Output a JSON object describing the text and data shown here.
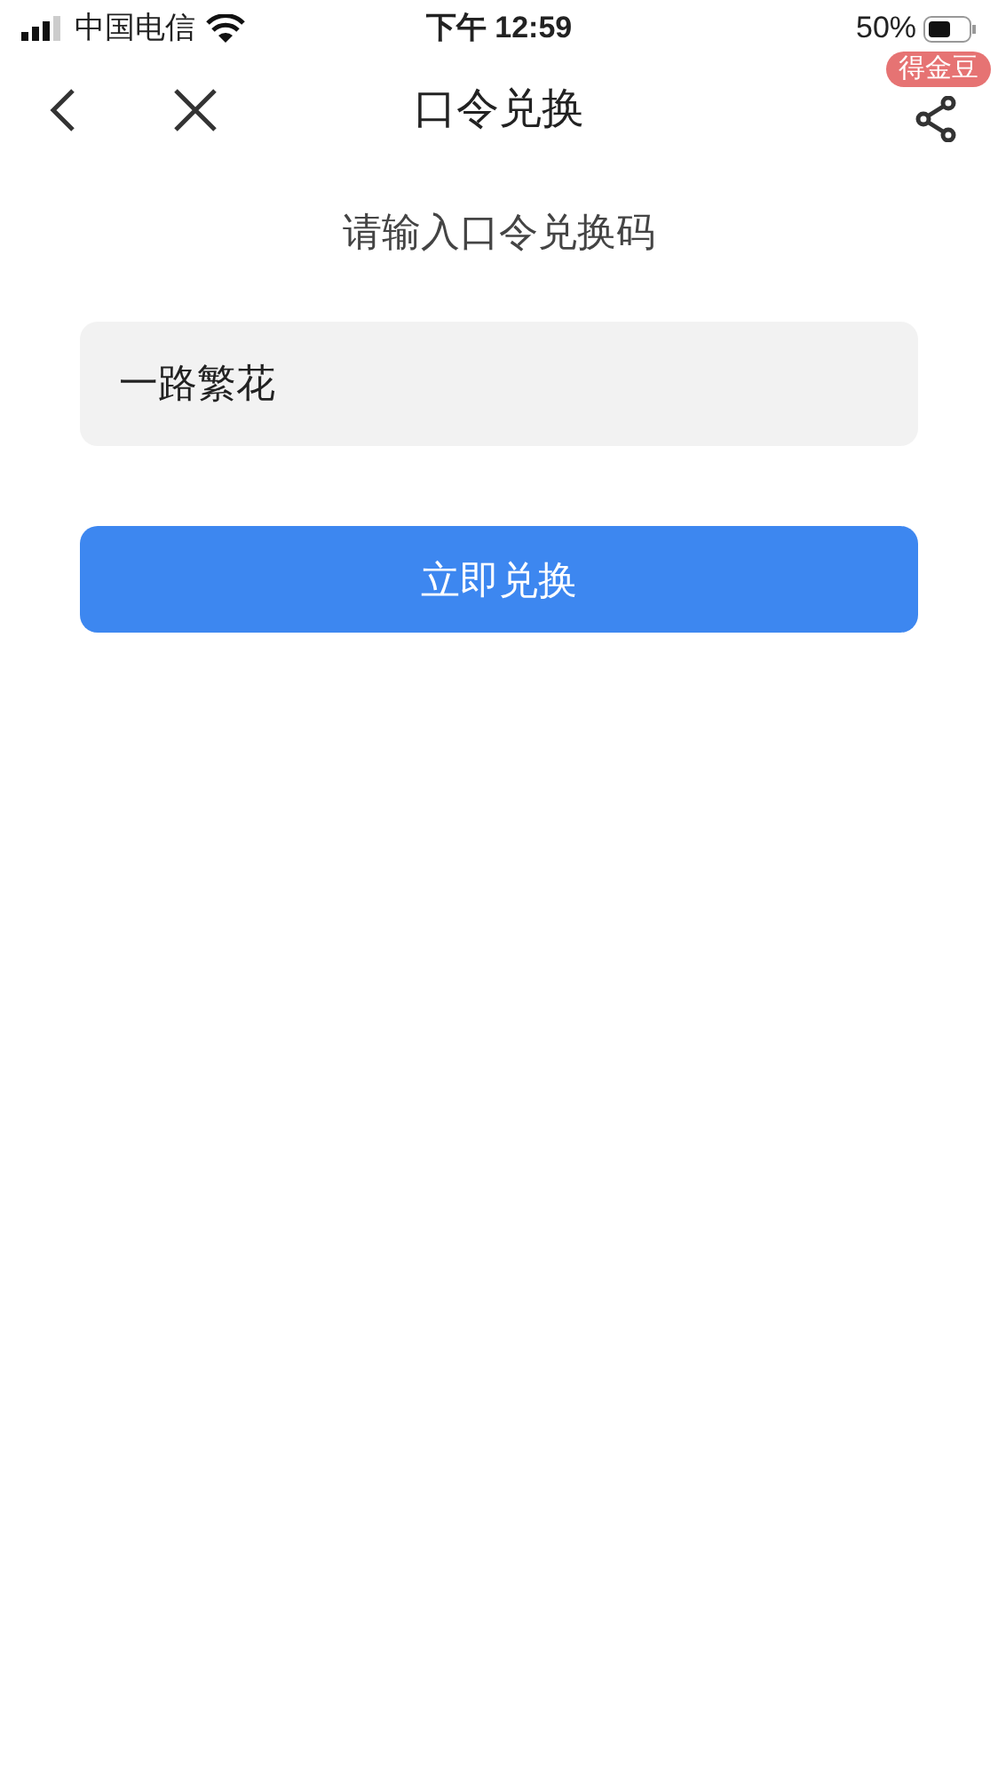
{
  "status_bar": {
    "carrier": "中国电信",
    "time": "下午 12:59",
    "battery": "50%"
  },
  "nav": {
    "title": "口令兑换",
    "badge": "得金豆"
  },
  "prompt": "请输入口令兑换码",
  "code_field": {
    "value": "一路繁花"
  },
  "submit_button": "立即兑换"
}
